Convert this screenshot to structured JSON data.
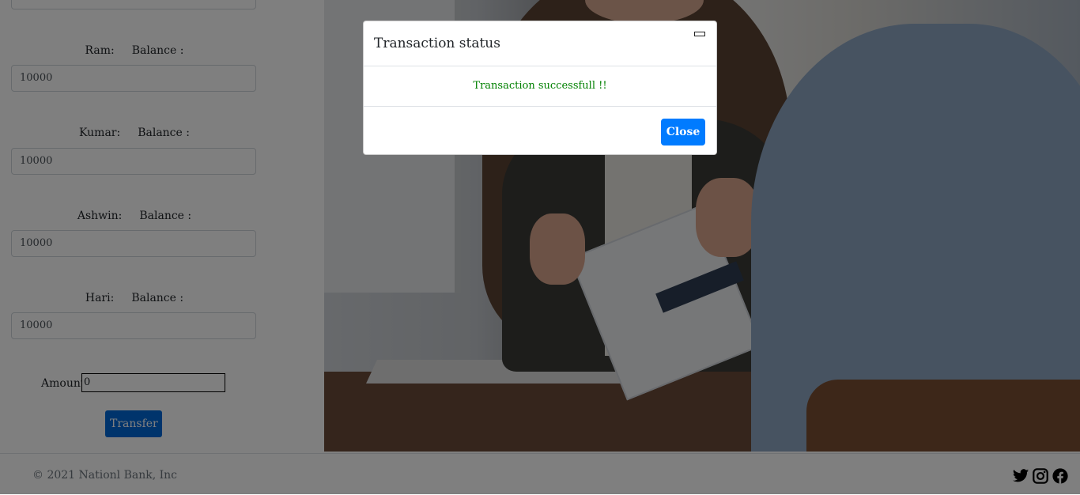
{
  "accounts": [
    {
      "name": "Ram:",
      "balance_label": "Balance :",
      "balance_value": "10000"
    },
    {
      "name": "Kumar:",
      "balance_label": "Balance :",
      "balance_value": "10000"
    },
    {
      "name": "Ashwin:",
      "balance_label": "Balance :",
      "balance_value": "10000"
    },
    {
      "name": "Hari:",
      "balance_label": "Balance :",
      "balance_value": "10000"
    }
  ],
  "transfer_form": {
    "amount_label": "Amount:",
    "amount_value": "0",
    "transfer_button": "Transfer"
  },
  "footer": {
    "copyright": "© 2021 Nationl Bank, Inc",
    "social_icons": [
      "twitter-icon",
      "instagram-icon",
      "facebook-icon"
    ]
  },
  "modal": {
    "title": "Transaction status",
    "message": "Transaction successfull !!",
    "close_button": "Close",
    "message_color": "#008000"
  },
  "colors": {
    "primary_button": "#007bff",
    "transfer_button": "#0069d9"
  }
}
